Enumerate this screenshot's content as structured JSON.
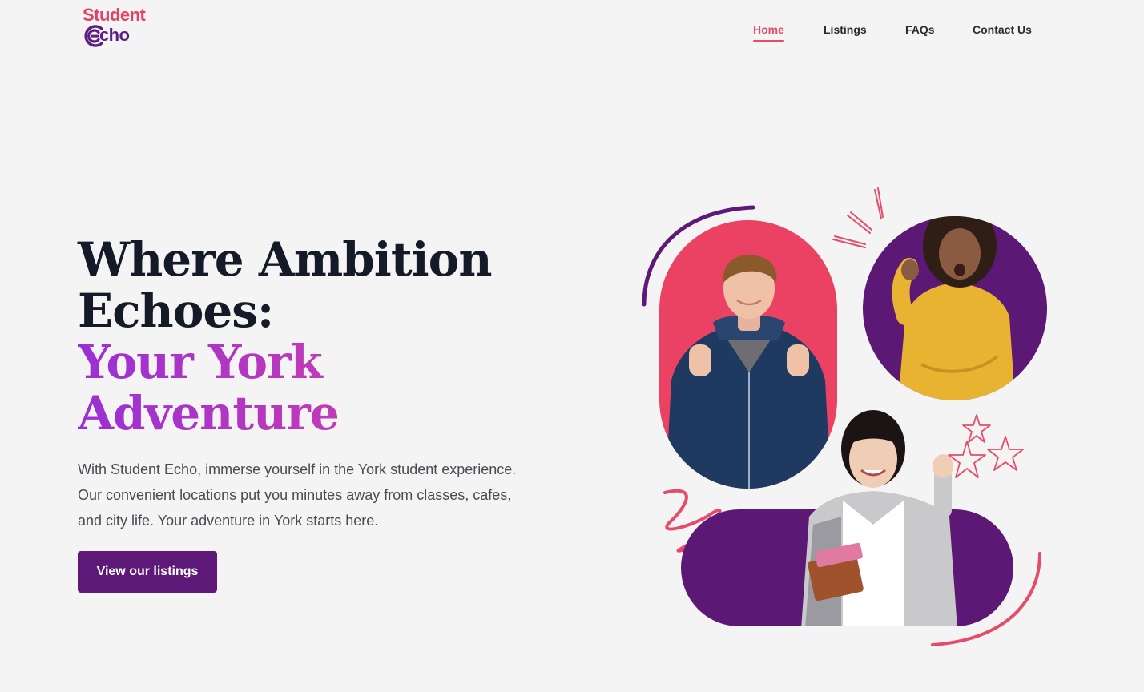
{
  "brand": {
    "name_top": "Student",
    "name_bottom_rest": "cho",
    "colors": {
      "pink": "#e63f64",
      "purple": "#5e1f84"
    }
  },
  "nav": {
    "items": [
      {
        "label": "Home",
        "active": true
      },
      {
        "label": "Listings",
        "active": false
      },
      {
        "label": "FAQs",
        "active": false
      },
      {
        "label": "Contact Us",
        "active": false
      }
    ]
  },
  "hero": {
    "headline_line1": "Where Ambition",
    "headline_line2": "Echoes:",
    "headline_accent_line1": "Your York",
    "headline_accent_line2": "Adventure",
    "body": "With Student Echo, immerse yourself in the York student experience. Our convenient locations put you minutes away from classes, cafes, and city life. Your adventure in York starts here.",
    "cta_label": "View our listings"
  },
  "colors": {
    "background": "#f5f4f5",
    "accent_pink": "#e64b68",
    "accent_purple": "#5e1978",
    "headline": "#141a28"
  }
}
